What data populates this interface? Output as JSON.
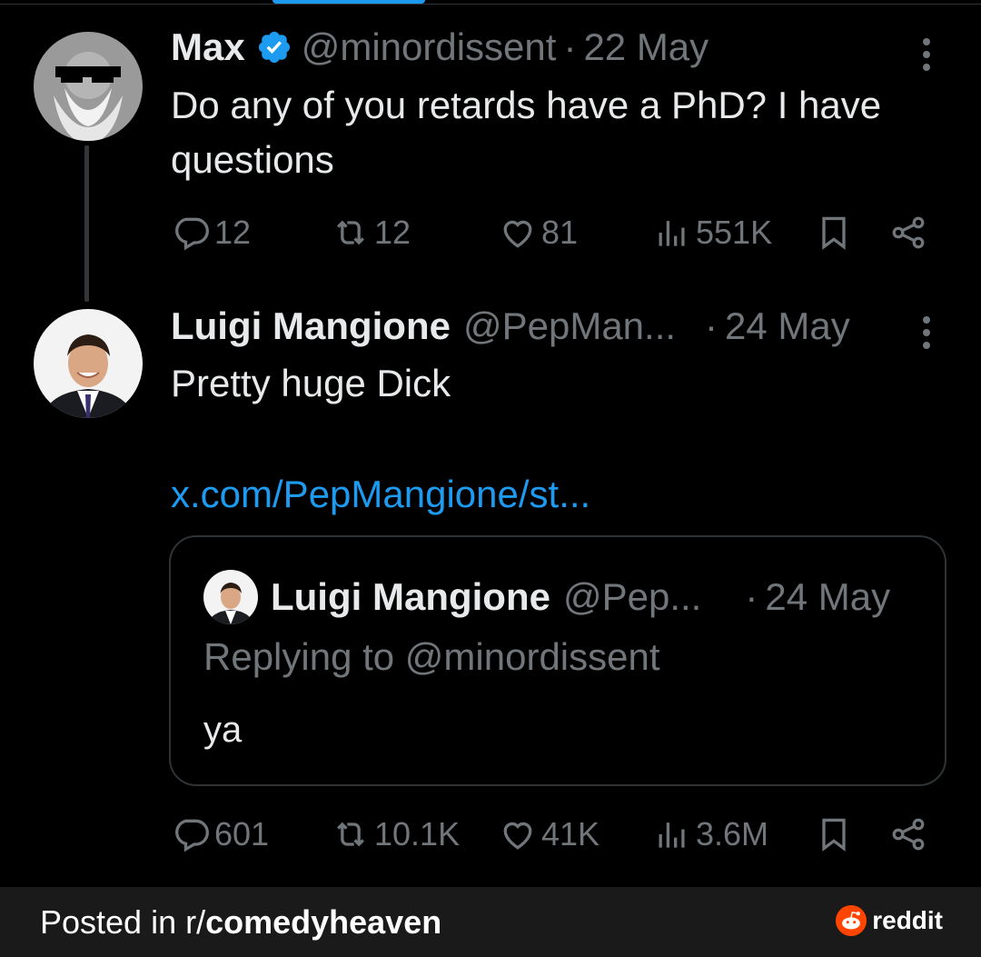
{
  "colors": {
    "background": "#000000",
    "muted": "#71767b",
    "link": "#1d9bf0",
    "verified": "#1d9bf0",
    "reddit": "#ff4500"
  },
  "tweet1": {
    "name": "Max",
    "handle": "@minordissent",
    "separator": "·",
    "date": "22 May",
    "text": "Do any of you retards have a PhD? I have questions",
    "stats": {
      "replies": "12",
      "reposts": "12",
      "likes": "81",
      "views": "551K"
    },
    "icons": [
      "reply-icon",
      "repost-icon",
      "like-icon",
      "views-icon",
      "bookmark-icon",
      "share-icon"
    ]
  },
  "tweet2": {
    "name": "Luigi Mangione",
    "handle": "@PepMan...",
    "separator": "·",
    "date": "24 May",
    "text": "Pretty huge Dick",
    "link": "x.com/PepMangione/st...",
    "quote": {
      "name": "Luigi Mangione",
      "handle": "@Pep...",
      "separator": "·",
      "date": "24 May",
      "replying_to": "Replying to",
      "replying_handle": "@minordissent",
      "text": "ya"
    },
    "stats": {
      "replies": "601",
      "reposts": "10.1K",
      "likes": "41K",
      "views": "3.6M"
    }
  },
  "footer": {
    "posted_prefix": "Posted in r/",
    "subreddit": "comedyheaven",
    "brand": "reddit"
  }
}
